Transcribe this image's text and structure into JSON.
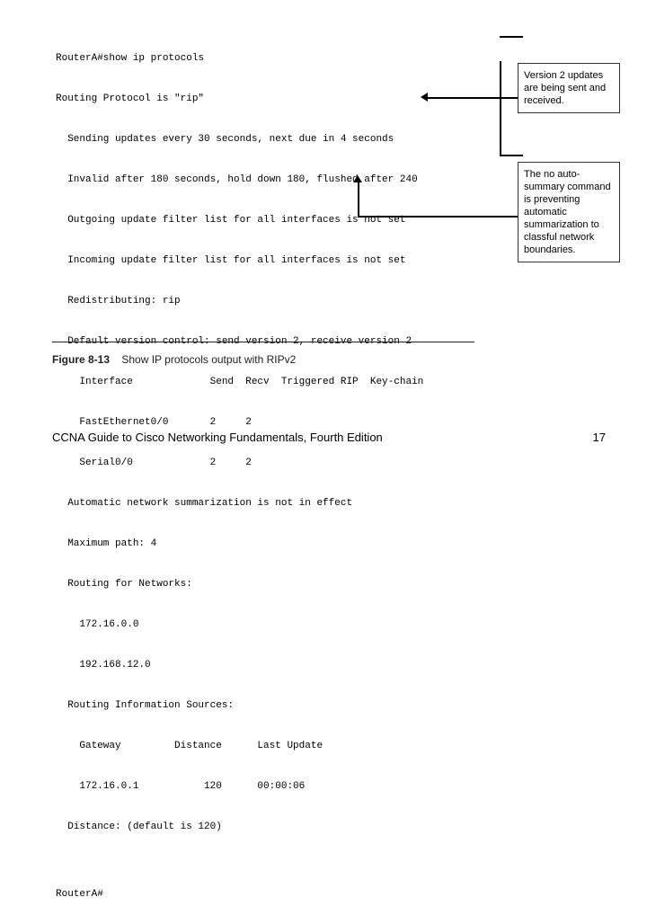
{
  "terminal": {
    "lines": [
      "RouterA#show ip protocols",
      "Routing Protocol is \"rip\"",
      "  Sending updates every 30 seconds, next due in 4 seconds",
      "  Invalid after 180 seconds, hold down 180, flushed after 240",
      "  Outgoing update filter list for all interfaces is not set",
      "  Incoming update filter list for all interfaces is not set",
      "  Redistributing: rip",
      "  Default version control: send version 2, receive version 2",
      "    Interface             Send  Recv  Triggered RIP  Key-chain",
      "    FastEthernet0/0       2     2",
      "    Serial0/0             2     2",
      "  Automatic network summarization is not in effect",
      "  Maximum path: 4",
      "  Routing for Networks:",
      "    172.16.0.0",
      "    192.168.12.0",
      "  Routing Information Sources:",
      "    Gateway         Distance      Last Update",
      "    172.16.0.1           120      00:00:06",
      "  Distance: (default is 120)",
      "",
      "RouterA#"
    ]
  },
  "annotations": {
    "a1": "Version 2 updates are being sent and received.",
    "a2": "The no auto-summary command is preventing automatic summarization to classful network boundaries."
  },
  "caption": {
    "label": "Figure 8-13",
    "text": "Show IP protocols output with RIPv2"
  },
  "footer": {
    "left": "CCNA Guide to Cisco Networking Fundamentals, Fourth Edition",
    "right": "17"
  }
}
